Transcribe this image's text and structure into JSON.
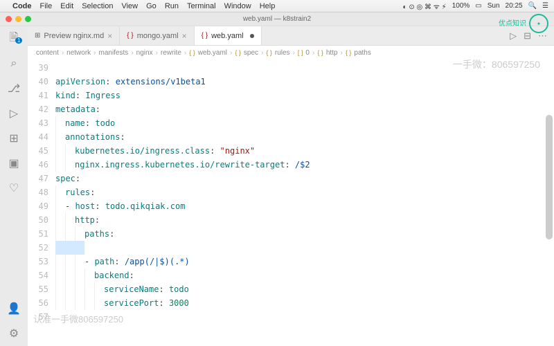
{
  "menubar": {
    "app": "Code",
    "items": [
      "File",
      "Edit",
      "Selection",
      "View",
      "Go",
      "Run",
      "Terminal",
      "Window",
      "Help"
    ],
    "right": {
      "battery": "100%",
      "day": "Sun",
      "time": "20:25"
    }
  },
  "window": {
    "title": "web.yaml — k8strain2"
  },
  "tabs": [
    {
      "label": "Preview nginx.md",
      "icon": "⊞",
      "active": false,
      "modified": false
    },
    {
      "label": "mongo.yaml",
      "icon": "{ }",
      "iconColor": "#a31515",
      "active": false,
      "modified": false
    },
    {
      "label": "web.yaml",
      "icon": "{ }",
      "iconColor": "#a31515",
      "active": true,
      "modified": true
    }
  ],
  "breadcrumb": [
    "content",
    "network",
    "manifests",
    "nginx",
    "rewrite",
    "web.yaml",
    "spec",
    "rules",
    "0",
    "http",
    "paths"
  ],
  "lineStart": 39,
  "code": [
    "",
    "apiVersion: extensions/v1beta1",
    "kind: Ingress",
    "metadata:",
    "  name: todo",
    "  annotations:",
    "    kubernetes.io/ingress.class: \"nginx\"",
    "    nginx.ingress.kubernetes.io/rewrite-target: /$2",
    "spec:",
    "  rules:",
    "  - host: todo.qikqiak.com",
    "    http:",
    "      paths:",
    "      ",
    "      - path: /app(/|$)(.*)",
    "        backend:",
    "          serviceName: todo",
    "          servicePort: 3000",
    ""
  ],
  "selectedLine": 13,
  "watermarks": {
    "top": "一手微：806597250",
    "bottom": "认准一手微806597250",
    "logo": "优点知识"
  },
  "activitybar_badge": "1"
}
